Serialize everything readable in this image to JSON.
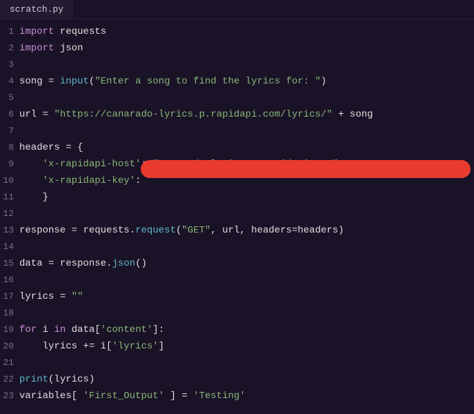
{
  "tab": {
    "filename": "scratch.py"
  },
  "lines": [
    {
      "n": 1
    },
    {
      "n": 2
    },
    {
      "n": 3
    },
    {
      "n": 4
    },
    {
      "n": 5
    },
    {
      "n": 6
    },
    {
      "n": 7
    },
    {
      "n": 8
    },
    {
      "n": 9
    },
    {
      "n": 10
    },
    {
      "n": 11
    },
    {
      "n": 12
    },
    {
      "n": 13
    },
    {
      "n": 14
    },
    {
      "n": 15
    },
    {
      "n": 16
    },
    {
      "n": 17
    },
    {
      "n": 18
    },
    {
      "n": 19
    },
    {
      "n": 20
    },
    {
      "n": 21
    },
    {
      "n": 22
    },
    {
      "n": 23
    }
  ],
  "code": {
    "l1": {
      "import": "import",
      "requests": "requests"
    },
    "l2": {
      "import": "import",
      "json": "json"
    },
    "l4": {
      "song": "song",
      "eq": " = ",
      "input": "input",
      "open": "(",
      "str": "\"Enter a song to find the lyrics for: \"",
      "close": ")"
    },
    "l6": {
      "url": "url",
      "eq": " = ",
      "str": "\"https://canarado-lyrics.p.rapidapi.com/lyrics/\"",
      "plus": " + ",
      "song": "song"
    },
    "l8": {
      "headers": "headers",
      "eq": " = {",
      "open": ""
    },
    "l9": {
      "indent": "    ",
      "key": "'x-rapidapi-host'",
      "colon": ": ",
      "val": "\"canarado-lyrics.p.rapidapi.com\"",
      "comma": ","
    },
    "l10": {
      "indent": "    ",
      "key": "'x-rapidapi-key'",
      "colon": ":"
    },
    "l11": {
      "indent": "    ",
      "close": "}"
    },
    "l13": {
      "response": "response",
      "eq": " = ",
      "requests": "requests",
      "dot": ".",
      "request": "request",
      "open": "(",
      "get": "\"GET\"",
      "c1": ", ",
      "url": "url",
      "c2": ", ",
      "hdrs": "headers",
      "eq2": "=",
      "hdrs2": "headers",
      "close": ")"
    },
    "l15": {
      "data": "data",
      "eq": " = ",
      "response": "response",
      "dot": ".",
      "json": "json",
      "parens": "()"
    },
    "l17": {
      "lyrics": "lyrics",
      "eq": " = ",
      "empty": "\"\""
    },
    "l19": {
      "for": "for",
      "sp1": " ",
      "i": "i",
      "sp2": " ",
      "in": "in",
      "sp3": " ",
      "data": "data",
      "open": "[",
      "content": "'content'",
      "close": "]:"
    },
    "l20": {
      "indent": "    ",
      "lyrics": "lyrics",
      "pluseq": " += ",
      "i": "i",
      "open": "[",
      "key": "'lyrics'",
      "close": "]"
    },
    "l22": {
      "print": "print",
      "open": "(",
      "lyrics": "lyrics",
      "close": ")"
    },
    "l23": {
      "variables": "variables",
      "open": "[ ",
      "key": "'First_Output'",
      "close": " ] = ",
      "val": "'Testing'"
    }
  },
  "redaction": {
    "present": true
  }
}
